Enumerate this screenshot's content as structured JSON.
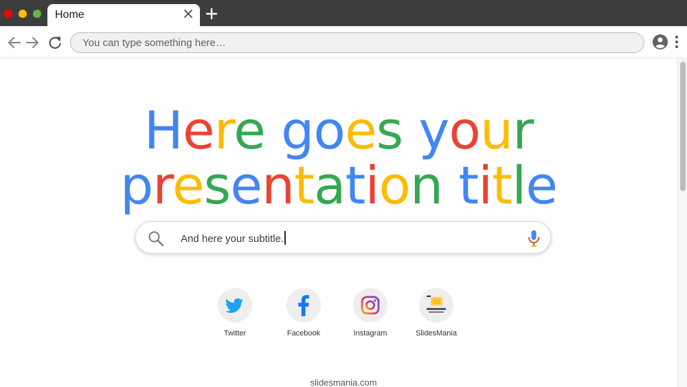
{
  "browser": {
    "tab_title": "Home",
    "omnibox_placeholder": "You can type something here…"
  },
  "hero": {
    "line1": [
      {
        "text": "H",
        "color": "#4285f4"
      },
      {
        "text": "e",
        "color": "#ea4335"
      },
      {
        "text": "r",
        "color": "#fbbc05"
      },
      {
        "text": "e",
        "color": "#34a853"
      },
      {
        "text": " ",
        "color": "#000000"
      },
      {
        "text": "g",
        "color": "#4285f4"
      },
      {
        "text": "o",
        "color": "#4285f4"
      },
      {
        "text": "e",
        "color": "#fbbc05"
      },
      {
        "text": "s",
        "color": "#34a853"
      },
      {
        "text": " ",
        "color": "#000000"
      },
      {
        "text": "y",
        "color": "#4285f4"
      },
      {
        "text": "o",
        "color": "#ea4335"
      },
      {
        "text": "u",
        "color": "#fbbc05"
      },
      {
        "text": "r",
        "color": "#34a853"
      }
    ],
    "line2": [
      {
        "text": "p",
        "color": "#4285f4"
      },
      {
        "text": "r",
        "color": "#ea4335"
      },
      {
        "text": "e",
        "color": "#fbbc05"
      },
      {
        "text": "s",
        "color": "#34a853"
      },
      {
        "text": "e",
        "color": "#4285f4"
      },
      {
        "text": "n",
        "color": "#ea4335"
      },
      {
        "text": "t",
        "color": "#fbbc05"
      },
      {
        "text": "a",
        "color": "#34a853"
      },
      {
        "text": "t",
        "color": "#4285f4"
      },
      {
        "text": "i",
        "color": "#ea4335"
      },
      {
        "text": "o",
        "color": "#fbbc05"
      },
      {
        "text": "n",
        "color": "#34a853"
      },
      {
        "text": " ",
        "color": "#000000"
      },
      {
        "text": "t",
        "color": "#4285f4"
      },
      {
        "text": "i",
        "color": "#ea4335"
      },
      {
        "text": "t",
        "color": "#fbbc05"
      },
      {
        "text": "l",
        "color": "#34a853"
      },
      {
        "text": "e",
        "color": "#4285f4"
      }
    ]
  },
  "search": {
    "value": "And here your subtitle."
  },
  "shortcuts": [
    {
      "label": "Twitter",
      "icon": "twitter-icon"
    },
    {
      "label": "Facebook",
      "icon": "facebook-icon"
    },
    {
      "label": "Instagram",
      "icon": "instagram-icon"
    },
    {
      "label": "SlidesMania",
      "icon": "slidesmania-logo"
    }
  ],
  "footer": {
    "link": "slidesmania.com"
  },
  "colors": {
    "google_blue": "#4285f4",
    "google_red": "#ea4335",
    "google_yellow": "#fbbc05",
    "google_green": "#34a853"
  }
}
